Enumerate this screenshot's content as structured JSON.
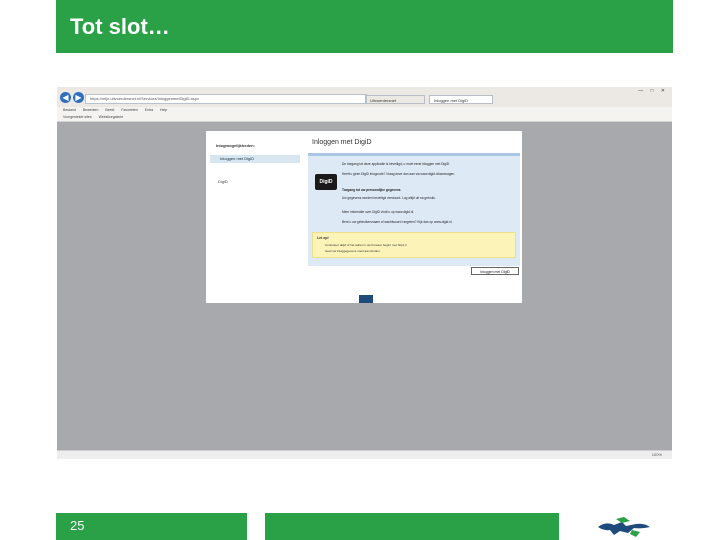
{
  "slide": {
    "title": "Tot slot…",
    "page_number": "25",
    "accent_color": "#2aa146"
  },
  "browser": {
    "address_url": "https://mijn.uitvoerdersnet.nl/Services/InloggenmetDigiD.aspx",
    "tabs": [
      "Uitvoerdersnet",
      "Inloggen met DigiD"
    ],
    "window_controls": "— □ ✕",
    "menu_items": [
      "Bestand",
      "Bewerken",
      "Beeld",
      "Favorieten",
      "Extra",
      "Help"
    ],
    "favorites_items": [
      "Voorgestelde sites",
      "Webslicegalerie"
    ],
    "zoom": "100%"
  },
  "page": {
    "sidebar_title": "Inlogmogelijkheden:",
    "sidebar_selected": "Inloggen met DigiD",
    "sidebar_other": "DigiD",
    "heading": "Inloggen met DigiD",
    "logo_text": "DigiD",
    "panel_lines": [
      "De toegang tot deze applicatie is beveiligd, u moet eerst inloggen met DigiD.",
      "Heeft u geen DigiD inlogcode? Vraag deze dan aan via www.digid.nl/aanvragen.",
      "Toegang tot uw persoonlijke gegevens",
      "Uw gegevens worden beveiligd verstuurd. Log altijd uit na gebruik.",
      "Meer informatie over DigiD vindt u op www.digid.nl.",
      "Bent u uw gebruikersnaam of wachtwoord vergeten? Kijk dan op www.digid.nl."
    ],
    "note_title": "Let op!",
    "note_lines": [
      "Controleer altijd of het adres in uw browser begint met https://",
      "Geef uw inloggegevens nooit aan derden."
    ],
    "login_button": "Inloggen met DigiD"
  }
}
